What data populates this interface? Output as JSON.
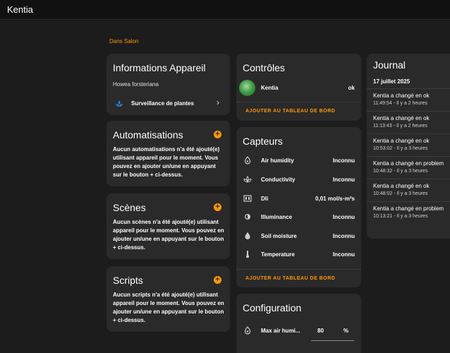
{
  "app": {
    "title": "Kentia"
  },
  "breadcrumb": "Dans Salon",
  "device_info": {
    "title": "Informations Appareil",
    "model": "Howea forsteriana",
    "integration_label": "Surveillance de plantes"
  },
  "automations": {
    "title": "Automatisations",
    "text": "Aucun automatisations n'a été ajouté(e) utilisant appareil pour le moment. Vous pouvez en ajouter un/une en appuyant sur le bouton + ci-dessus."
  },
  "scenes": {
    "title": "Scènes",
    "text": "Aucun scènes n'a été ajouté(e) utilisant appareil pour le moment. Vous pouvez en ajouter un/une en appuyant sur le bouton + ci-dessus."
  },
  "scripts": {
    "title": "Scripts",
    "text": "Aucun scripts n'a été ajouté(e) utilisant appareil pour le moment. Vous pouvez en ajouter un/une en appuyant sur le bouton + ci-dessus."
  },
  "controls": {
    "title": "Contrôles",
    "entity_name": "Kentia",
    "entity_state": "ok",
    "add_label": "AJOUTER AU TABLEAU DE BORD"
  },
  "sensors": {
    "title": "Capteurs",
    "items": [
      {
        "label": "Air humidity",
        "value": "Inconnu",
        "icon": "water-drop-icon"
      },
      {
        "label": "Conductivity",
        "value": "Inconnu",
        "icon": "spa-icon"
      },
      {
        "label": "Dli",
        "value": "0,01 mol/s⋅m²s",
        "icon": "counter-icon"
      },
      {
        "label": "Illuminance",
        "value": "Inconnu",
        "icon": "brightness-icon"
      },
      {
        "label": "Soil moisture",
        "value": "Inconnu",
        "icon": "water-icon"
      },
      {
        "label": "Temperature",
        "value": "Inconnu",
        "icon": "thermometer-icon"
      }
    ],
    "add_label": "AJOUTER AU TABLEAU DE BORD"
  },
  "configuration": {
    "title": "Configuration",
    "item_label": "Max air humi...",
    "item_value": "80",
    "item_unit": "%"
  },
  "journal": {
    "title": "Journal",
    "date": "17 juillet 2025",
    "entries": [
      {
        "message": "Kentia a changé en ok",
        "time": "11:49:54 - Il y a 2 heures"
      },
      {
        "message": "Kentia a changé en ok",
        "time": "11:13:43 - Il y a 2 heures"
      },
      {
        "message": "Kentia a changé en ok",
        "time": "10:53:02 - Il y a 3 heures"
      },
      {
        "message": "Kentia a changé en problem",
        "time": "10:48:32 - Il y a 3 heures"
      },
      {
        "message": "Kentia a changé en ok",
        "time": "10:48:02 - Il y a 3 heures"
      },
      {
        "message": "Kentia a changé en problem",
        "time": "10:13:21 - Il y a 3 heures"
      }
    ]
  },
  "colors": {
    "accent": "#ff9800",
    "card": "#2a2a2a",
    "background": "#1c1c1c",
    "plant_icon": "#1e88e5"
  }
}
